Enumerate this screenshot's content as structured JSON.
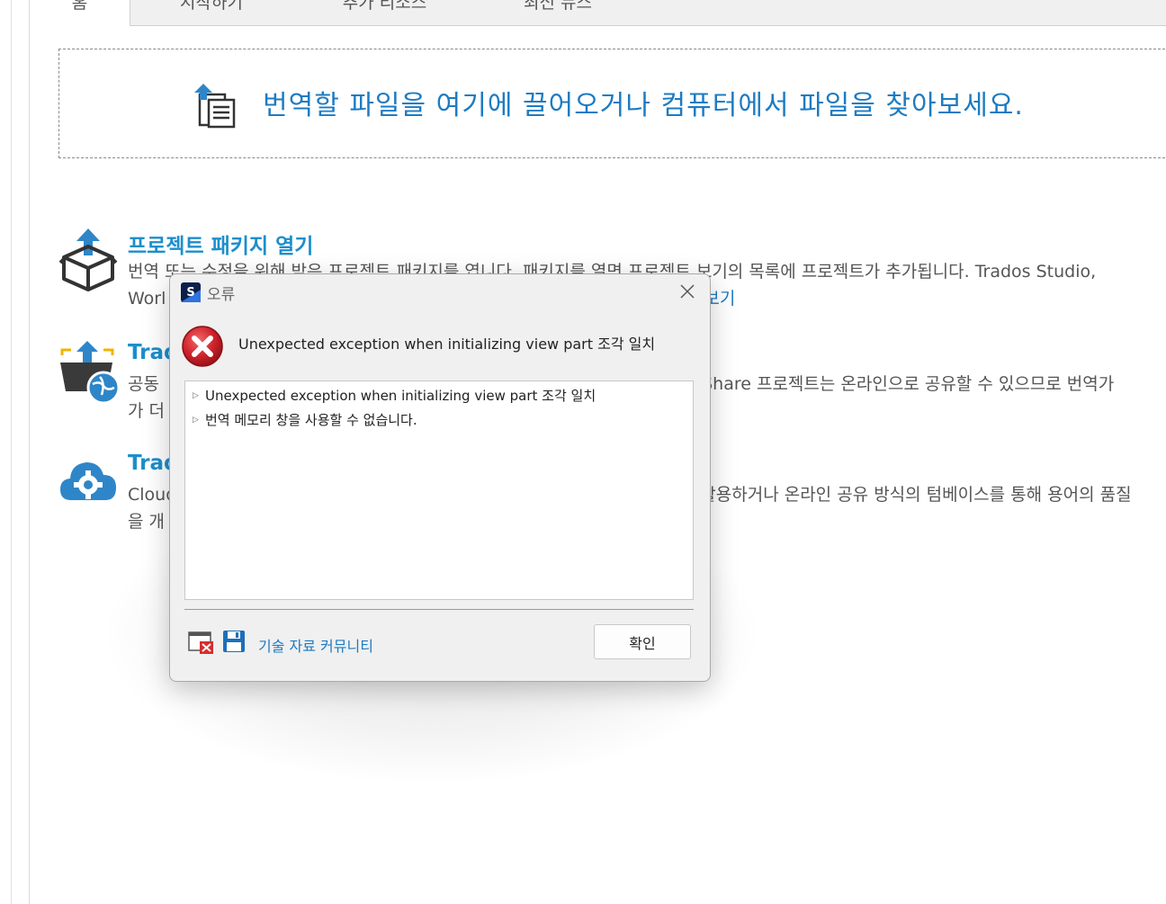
{
  "tabs": [
    {
      "label": "홈"
    },
    {
      "label": "시작하기"
    },
    {
      "label": "추가 리소스"
    },
    {
      "label": "최신 뉴스"
    }
  ],
  "dropzone": {
    "icon": "file-upload-icon",
    "text": "번역할 파일을 여기에 끌어오거나 컴퓨터에서 파일을 찾아보세요."
  },
  "features": [
    {
      "icon": "package-open-icon",
      "title": "프로젝트 패키지 열기",
      "desc_line1": "번역 또는 수정을 위해 받은 프로젝트 패키지를 엽니다. 패키지를 열면 프로젝트 보기의 목록에 프로젝트가 추가됩니다. Trados Studio,",
      "desc_line2": "Worl",
      "link": "보기"
    },
    {
      "icon": "groupshare-globe-icon",
      "title": "Trad",
      "desc_line1_start": "공동 ",
      "desc_line1_end": "upShare 프로젝트는 온라인으로 공유할 수 있으므로 번역가",
      "desc_line2": "가 더"
    },
    {
      "icon": "cloud-gear-icon",
      "title": "Trad",
      "desc_line1_start": "Cloud",
      "desc_line1_end": "활용하거나 온라인 공유 방식의 텀베이스를 통해 용어의 품질",
      "desc_line2": "을 개"
    }
  ],
  "dialog": {
    "title": "오류",
    "message": "Unexpected exception when initializing view part 조각 일치",
    "details": [
      "Unexpected exception when initializing view part 조각 일치",
      "번역 메모리 창을 사용할 수 없습니다."
    ],
    "footer_link": "기술 자료 커뮤니티",
    "ok_label": "확인",
    "colors": {
      "error": "#c8202a",
      "link": "#1d7bc2"
    }
  }
}
